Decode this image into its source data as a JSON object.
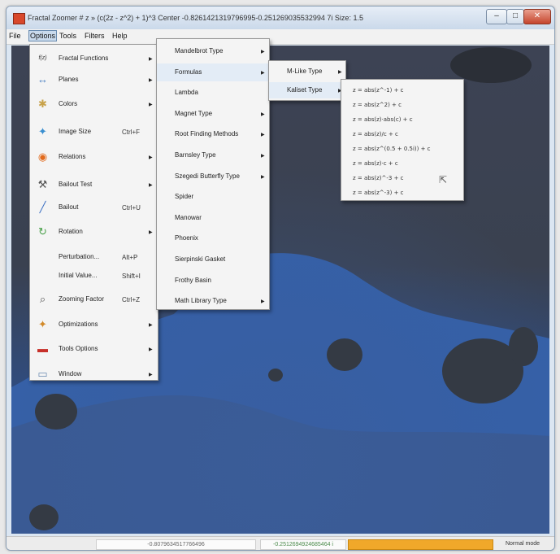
{
  "window": {
    "title": "Fractal Zoomer # z » (c(2z - z^2) + 1)^3  Center -0.8261421319796995-0.251269035532994 7i  Size: 1.5",
    "buttons": {
      "minimize": "–",
      "maximize": "□",
      "close": "✕"
    }
  },
  "menubar": [
    "File",
    "Options",
    "Tools",
    "Filters",
    "Help"
  ],
  "options_menu": [
    {
      "label": "Fractal Functions",
      "icon": "f(z)",
      "shortcut": "",
      "submenu": true
    },
    {
      "label": "Planes",
      "icon": "↔",
      "shortcut": "",
      "submenu": true
    },
    {
      "label": "Colors",
      "icon": "✱",
      "shortcut": "",
      "submenu": true
    },
    {
      "label": "Image Size",
      "icon": "✦",
      "shortcut": "Ctrl+F",
      "submenu": false
    },
    {
      "label": "Relations",
      "icon": "◉",
      "shortcut": "",
      "submenu": true
    },
    {
      "label": "Bailout Test",
      "icon": "⚒",
      "shortcut": "",
      "submenu": true
    },
    {
      "label": "Bailout",
      "icon": "╱",
      "shortcut": "Ctrl+U",
      "submenu": false
    },
    {
      "label": "Rotation",
      "icon": "↻",
      "shortcut": "",
      "submenu": true
    },
    {
      "label": "Perturbation...",
      "icon": "",
      "shortcut": "Alt+P",
      "submenu": false
    },
    {
      "label": "Initial Value...",
      "icon": "",
      "shortcut": "Shift+I",
      "submenu": false
    },
    {
      "label": "Zooming Factor",
      "icon": "⌕",
      "shortcut": "Ctrl+Z",
      "submenu": false
    },
    {
      "label": "Optimizations",
      "icon": "✦",
      "shortcut": "",
      "submenu": true
    },
    {
      "label": "Tools Options",
      "icon": "▬",
      "shortcut": "",
      "submenu": true
    },
    {
      "label": "Window",
      "icon": "▭",
      "shortcut": "",
      "submenu": true
    }
  ],
  "functions_menu": [
    {
      "label": "Mandelbrot Type",
      "submenu": true
    },
    {
      "label": "Formulas",
      "submenu": true
    },
    {
      "label": "Lambda",
      "submenu": false
    },
    {
      "label": "Magnet Type",
      "submenu": true
    },
    {
      "label": "Root Finding Methods",
      "submenu": true
    },
    {
      "label": "Barnsley Type",
      "submenu": true
    },
    {
      "label": "Szegedi Butterfly Type",
      "submenu": true
    },
    {
      "label": "Spider",
      "submenu": false
    },
    {
      "label": "Manowar",
      "submenu": false
    },
    {
      "label": "Phoenix",
      "submenu": false
    },
    {
      "label": "Sierpinski Gasket",
      "submenu": false
    },
    {
      "label": "Frothy Basin",
      "submenu": false
    },
    {
      "label": "Math Library Type",
      "submenu": true
    }
  ],
  "formulas_menu": [
    {
      "label": "M-Like Type",
      "submenu": true
    },
    {
      "label": "Kaliset Type",
      "submenu": true
    }
  ],
  "kaliset_menu": [
    "z = abs(z^-1) + c",
    "z = abs(z^2) + c",
    "z = abs(z)·abs(c) + c",
    "z = abs(z)/c + c",
    "z = abs(z^(0.5 + 0.5i)) + c",
    "z = abs(z)·c + c",
    "z = abs(z)^-3 + c",
    "z = abs(z^-3) + c"
  ],
  "statusbar": {
    "real": "-0.8079634517766496",
    "imag": "-0.2512694924685464 i",
    "mode": "Normal mode",
    "progress": 1.0
  },
  "colors": {
    "canvas_dark": "#3b404c",
    "canvas_blue": "#3a64a8",
    "menu_bg": "#f4f4f4",
    "highlight": "#c9daec",
    "progress": "#f0a82a",
    "title_bar": "#cad9ea"
  }
}
